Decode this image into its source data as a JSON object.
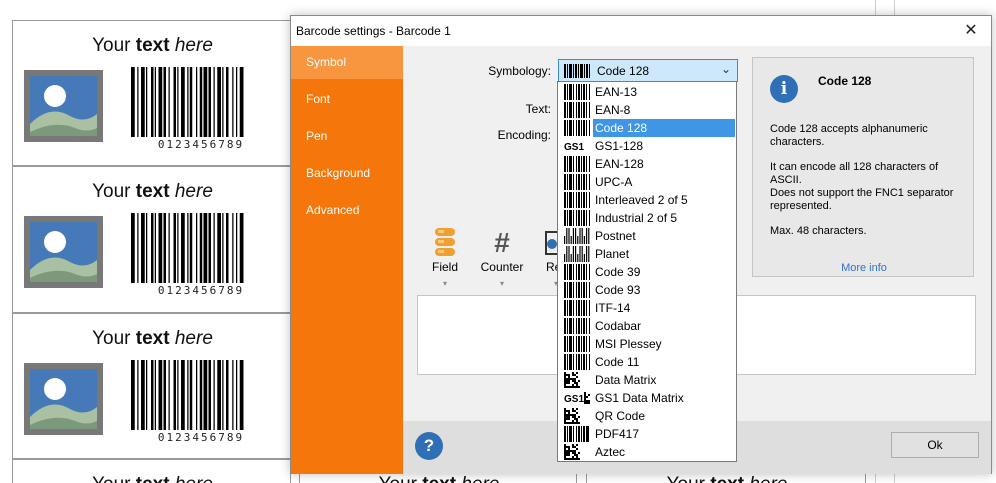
{
  "labels": {
    "text_plain": "Your",
    "text_bold": "text",
    "text_italic": "here",
    "barcode_digits": "0123456789"
  },
  "dialog": {
    "title": "Barcode settings - Barcode 1",
    "close_glyph": "✕",
    "sidebar": [
      {
        "label": "Symbol",
        "active": true
      },
      {
        "label": "Font",
        "active": false
      },
      {
        "label": "Pen",
        "active": false
      },
      {
        "label": "Background",
        "active": false
      },
      {
        "label": "Advanced",
        "active": false
      }
    ],
    "fields": {
      "symbology_label": "Symbology:",
      "text_label": "Text:",
      "encoding_label": "Encoding:"
    },
    "symbology_value": "Code 128",
    "dropdown_arrow": "⌄",
    "symbology_options": [
      {
        "label": "EAN-13",
        "icon": "barcode-icon"
      },
      {
        "label": "EAN-8",
        "icon": "barcode-icon"
      },
      {
        "label": "Code 128",
        "icon": "barcode-icon",
        "selected": true
      },
      {
        "label": "GS1-128",
        "icon": "gs1-icon"
      },
      {
        "label": "EAN-128",
        "icon": "barcode-icon"
      },
      {
        "label": "UPC-A",
        "icon": "barcode-icon"
      },
      {
        "label": "Interleaved 2 of 5",
        "icon": "barcode-icon"
      },
      {
        "label": "Industrial 2 of 5",
        "icon": "barcode-icon"
      },
      {
        "label": "Postnet",
        "icon": "postal-barcode-icon"
      },
      {
        "label": "Planet",
        "icon": "postal-barcode-icon"
      },
      {
        "label": "Code 39",
        "icon": "barcode-icon"
      },
      {
        "label": "Code 93",
        "icon": "barcode-icon"
      },
      {
        "label": "ITF-14",
        "icon": "itf-barcode-icon"
      },
      {
        "label": "Codabar",
        "icon": "barcode-icon"
      },
      {
        "label": "MSI Plessey",
        "icon": "msi-barcode-icon"
      },
      {
        "label": "Code 11",
        "icon": "barcode-icon"
      },
      {
        "label": "Data Matrix",
        "icon": "datamatrix-icon"
      },
      {
        "label": "GS1 Data Matrix",
        "icon": "gs1-datamatrix-icon"
      },
      {
        "label": "QR Code",
        "icon": "qr-code-icon"
      },
      {
        "label": "PDF417",
        "icon": "pdf417-icon"
      },
      {
        "label": "Aztec",
        "icon": "aztec-icon"
      }
    ],
    "gs1_text": "GS1",
    "info": {
      "glyph": "i",
      "title": "Code 128",
      "p1": "Code 128 accepts alphanumeric characters.",
      "p2a": "It can encode all 128 characters of ASCII.",
      "p2b": "Does not support the FNC1 separator represented.",
      "p3": "Max. 48 characters.",
      "more": "More info"
    },
    "tools": [
      {
        "label": "Field",
        "icon": "database-icon"
      },
      {
        "label": "Counter",
        "icon": "hash-icon"
      },
      {
        "label": "Refer",
        "icon": "reference-icon"
      }
    ],
    "tool_caret": "▾",
    "counter_glyph": "#",
    "help_glyph": "?",
    "ok_label": "Ok"
  },
  "colors": {
    "accent_orange": "#f5760a",
    "sidebar_active": "#f7963f",
    "selection_blue": "#3f95e6",
    "info_blue": "#2f6fb5"
  }
}
